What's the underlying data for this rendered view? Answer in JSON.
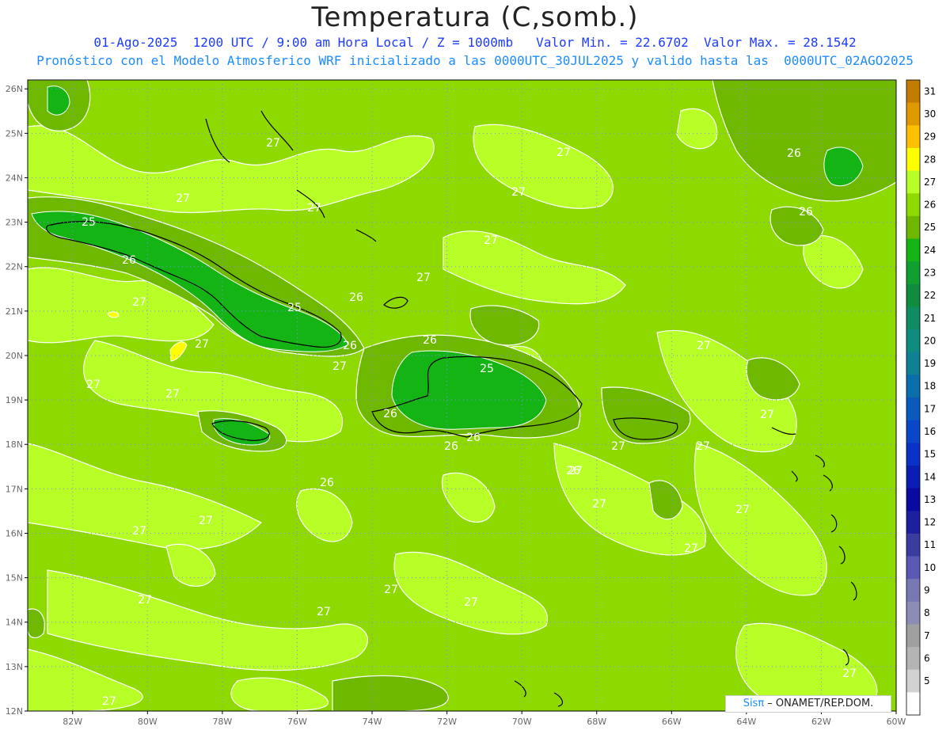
{
  "title": "Temperatura (C,somb.)",
  "subtitle_line1": "01-Ago-2025  1200 UTC / 9:00 am Hora Local / Z = 1000mb   Valor Min. = 22.6702  Valor Max. = 28.1542",
  "subtitle_line2": "Pronóstico con el Modelo Atmosferico WRF inicializado a las 0000UTC_30JUL2025 y valido hasta las  0000UTC_02AGO2025",
  "credit": {
    "logo": "Sisπ",
    "text": " – ONAMET/REP.DOM."
  },
  "lat_labels": [
    "26N",
    "25N",
    "24N",
    "23N",
    "22N",
    "21N",
    "20N",
    "19N",
    "18N",
    "17N",
    "16N",
    "15N",
    "14N",
    "13N",
    "12N"
  ],
  "lon_labels": [
    "82W",
    "80W",
    "78W",
    "76W",
    "74W",
    "72W",
    "70W",
    "68W",
    "66W",
    "64W",
    "62W",
    "60W"
  ],
  "colorbar": {
    "levels": [
      "31",
      "30",
      "29",
      "28",
      "27",
      "26",
      "25",
      "24",
      "23",
      "22",
      "21",
      "20",
      "19",
      "18",
      "17",
      "16",
      "15",
      "14",
      "13",
      "12",
      "11",
      "10",
      "9",
      "8",
      "7",
      "6",
      "5"
    ],
    "colors": [
      "#c27c00",
      "#e09a00",
      "#ffc000",
      "#ffff00",
      "#b8ff28",
      "#8ed900",
      "#6eb800",
      "#14b414",
      "#10a030",
      "#0f8c3c",
      "#0f8c64",
      "#0f8c80",
      "#0f8096",
      "#0a6eaa",
      "#0a5abe",
      "#0a46c8",
      "#0a32c8",
      "#0a1eb4",
      "#0a0aa0",
      "#1e1ea0",
      "#3c3ca0",
      "#5a5ab4",
      "#7878b4",
      "#8c8cb4",
      "#a0a0a0",
      "#b4b4b4",
      "#d2d2d2",
      "#ffffff"
    ]
  },
  "contour_labels": [
    "27",
    "27",
    "27",
    "27",
    "27",
    "26",
    "26",
    "25",
    "26",
    "27",
    "27",
    "26",
    "27",
    "27",
    "25",
    "26",
    "26",
    "27",
    "27",
    "27",
    "25",
    "26",
    "26",
    "26",
    "27",
    "27",
    "27",
    "26",
    "26",
    "27",
    "27",
    "27",
    "27",
    "27",
    "27",
    "27",
    "27",
    "27",
    "27",
    "27",
    "27",
    "27"
  ],
  "fill_colors": {
    "background": "#8ed900",
    "warm": "#b8ff28",
    "cool": "#6eb800",
    "cooler": "#14b414",
    "hot": "#ffff00",
    "land": "#000000"
  }
}
